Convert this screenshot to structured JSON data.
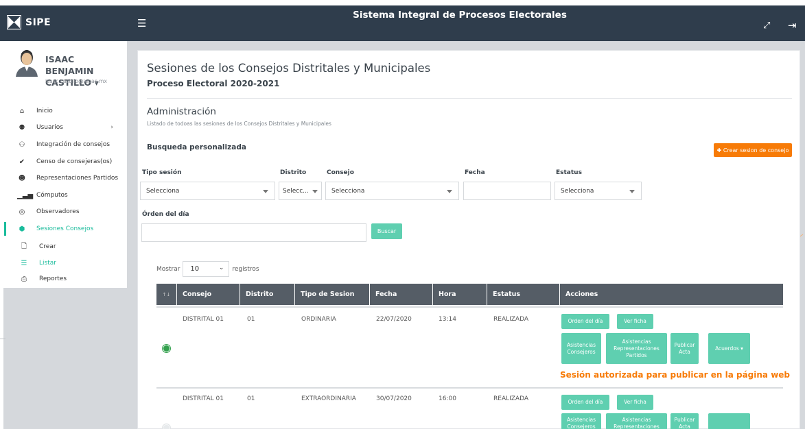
{
  "app": {
    "name": "SIPE",
    "system_title": "Sistema Integral de Procesos Electorales"
  },
  "user": {
    "name_line1": "ISAAC BENJAMIN",
    "name_line2": "CASTILLO ▾",
    "email": "isaac.castillo@iepac.mx"
  },
  "sidebar": {
    "items": [
      {
        "label": "Inicio",
        "icon": "home-icon"
      },
      {
        "label": "Usuarios",
        "icon": "users-icon"
      },
      {
        "label": "Integración de consejos",
        "icon": "group-icon"
      },
      {
        "label": "Censo de consejeras(os)",
        "icon": "check-icon"
      },
      {
        "label": "Representaciones Partidos",
        "icon": "people-icon"
      },
      {
        "label": "Cómputos",
        "icon": "bar-chart-icon"
      },
      {
        "label": "Observadores",
        "icon": "eye-icon"
      },
      {
        "label": "Sesiones Consejos",
        "icon": "cube-icon"
      }
    ],
    "subitems": [
      {
        "label": "Crear",
        "icon": "file-icon"
      },
      {
        "label": "Listar",
        "icon": "list-icon"
      },
      {
        "label": "Reportes",
        "icon": "pdf-icon"
      }
    ]
  },
  "page": {
    "title": "Sesiones de los Consejos Distritales y Municipales",
    "subtitle": "Proceso Electoral 2020-2021",
    "section_title": "Administración",
    "section_desc": "Listado de todoas las sesiones de los Consejos Distritales y Municipales",
    "search_title": "Busqueda personalizada",
    "create_button": "✚ Crear sesion de consejo"
  },
  "filters": {
    "tipo_label": "Tipo sesión",
    "tipo_value": "Selecciona",
    "distrito_label": "Distrito",
    "distrito_value": "Selecc...",
    "consejo_label": "Consejo",
    "consejo_value": "Selecciona",
    "fecha_label": "Fecha",
    "fecha_value": "",
    "estatus_label": "Estatus",
    "estatus_value": "Selecciona",
    "orden_label": "Órden del día",
    "orden_value": "",
    "search_button": "Buscar"
  },
  "table_controls": {
    "show_prefix": "Mostrar",
    "page_size": "10",
    "show_suffix": "registros"
  },
  "table": {
    "sort_glyph": "↑↓",
    "columns": [
      "Consejo",
      "Distrito",
      "Tipo de Sesion",
      "Fecha",
      "Hora",
      "Estatus",
      "Acciones"
    ],
    "rows": [
      {
        "consejo": "DISTRITAL 01",
        "distrito": "01",
        "tipo": "ORDINARIA",
        "fecha": "22/07/2020",
        "hora": "13:14",
        "estatus": "REALIZADA",
        "message": "Sesión autorizada para publicar en la página web"
      },
      {
        "consejo": "DISTRITAL 01",
        "distrito": "01",
        "tipo": "EXTRAORDINARIA",
        "fecha": "30/07/2020",
        "hora": "16:00",
        "estatus": "REALIZADA"
      }
    ],
    "actions": {
      "orden": "Orden del día",
      "ficha": "Ver ficha",
      "asistencias_consejeros": "Asistencias Consejeros",
      "asistencias_representaciones": "Asistencias Representaciones Partidos",
      "publicar_acta": "Publicar Acta",
      "acuerdos": "Acuerdos ▾"
    }
  },
  "colors": {
    "topbar": "#2f3d4c",
    "accent": "#1abc9c",
    "button": "#5fcfb0",
    "orange": "#f77b07",
    "table_header": "#555d66"
  }
}
